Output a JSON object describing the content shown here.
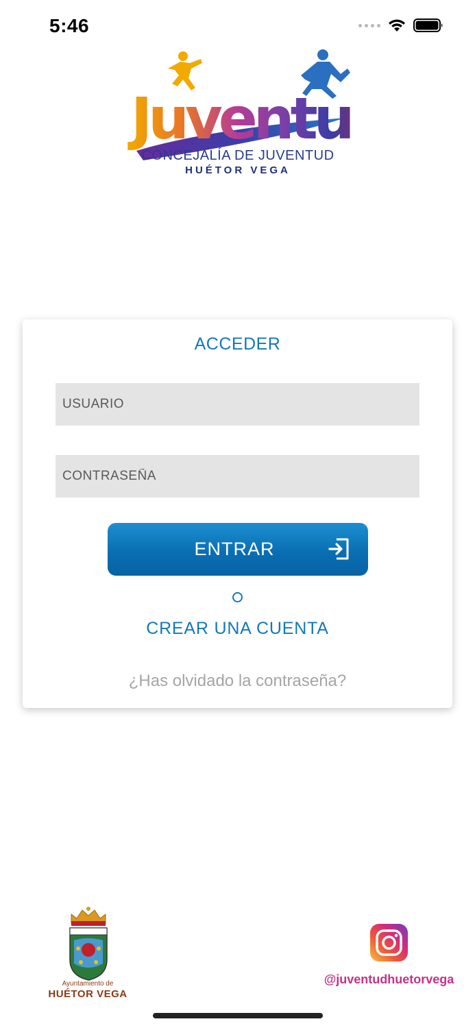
{
  "status_bar": {
    "time": "5:46"
  },
  "logo": {
    "title": "Juventud",
    "line1": "CONCEJALÍA DE JUVENTUD",
    "line2": "HUÉTOR VEGA"
  },
  "login": {
    "title": "ACCEDER",
    "user_placeholder": "USUARIO",
    "password_placeholder": "CONTRASEÑA",
    "enter_label": "ENTRAR",
    "create_account_label": "CREAR UNA CUENTA",
    "forgot_label": "¿Has olvidado la contraseña?"
  },
  "footer": {
    "ayuntamiento_small": "Ayuntamiento de",
    "ayuntamiento_big": "HUÉTOR VEGA",
    "instagram_handle": "@juventudhuetorvega"
  },
  "colors": {
    "accent": "#1378b9",
    "button": "#0a6fb3",
    "instagram_text": "#c2338a",
    "crest_text": "#8b3a14"
  },
  "icons": {
    "login": "login-arrow-icon",
    "instagram": "instagram-icon",
    "crest": "coat-of-arms-icon",
    "wifi": "wifi-icon",
    "battery": "battery-icon",
    "signal": "signal-icon"
  }
}
